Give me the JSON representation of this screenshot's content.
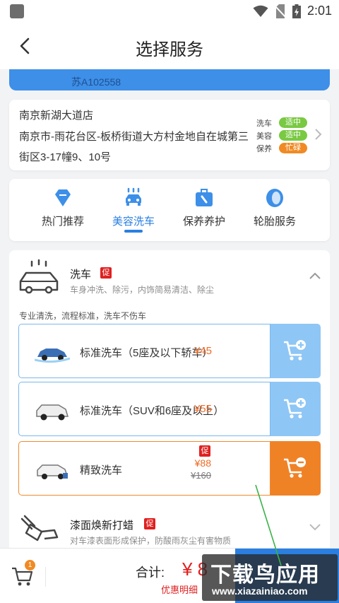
{
  "status_bar": {
    "time": "2:01"
  },
  "header": {
    "title": "选择服务"
  },
  "vehicle": {
    "plate": "苏A102558"
  },
  "store": {
    "name": "南京新湖大道店",
    "address": "南京市-雨花台区-板桥街道大方村金地自在城第三街区3-17幢9、10号",
    "statuses": [
      {
        "label": "洗车",
        "value": "适中",
        "color": "#7ac943"
      },
      {
        "label": "美容",
        "value": "适中",
        "color": "#7ac943"
      },
      {
        "label": "保养",
        "value": "忙碌",
        "color": "#f08a24"
      }
    ]
  },
  "categories": [
    {
      "label": "热门推荐",
      "icon": "diamond-icon",
      "active": false
    },
    {
      "label": "美容洗车",
      "icon": "car-wash-icon",
      "active": true
    },
    {
      "label": "保养养护",
      "icon": "maintenance-toolbox-icon",
      "active": false
    },
    {
      "label": "轮胎服务",
      "icon": "tire-icon",
      "active": false
    }
  ],
  "wash_section": {
    "name": "洗车",
    "promo": "促",
    "description": "车身冲洗、除污，内饰简易清洁、除尘",
    "note": "专业清洗，流程标准，洗车不伤车",
    "items": [
      {
        "name": "标准洗车（5座及以下轿车）",
        "price": "¥45",
        "selected": false
      },
      {
        "name": "标准洗车（SUV和6座及以上）",
        "price": "¥55",
        "selected": false
      },
      {
        "name": "精致洗车",
        "price": "¥88",
        "original_price": "¥160",
        "promo": "促",
        "selected": true
      }
    ]
  },
  "paint_section": {
    "name": "漆面焕新打蜡",
    "promo": "促",
    "description": "对车漆表面形成保护，防酸雨灰尘有害物质"
  },
  "bottom_bar": {
    "cart_count": "1",
    "total_label": "合计:",
    "total_value": "¥ 8",
    "detail_label": "优惠明细"
  },
  "watermark": {
    "line1": "下载鸟应用",
    "line2": "www.xiazainiao.com"
  }
}
